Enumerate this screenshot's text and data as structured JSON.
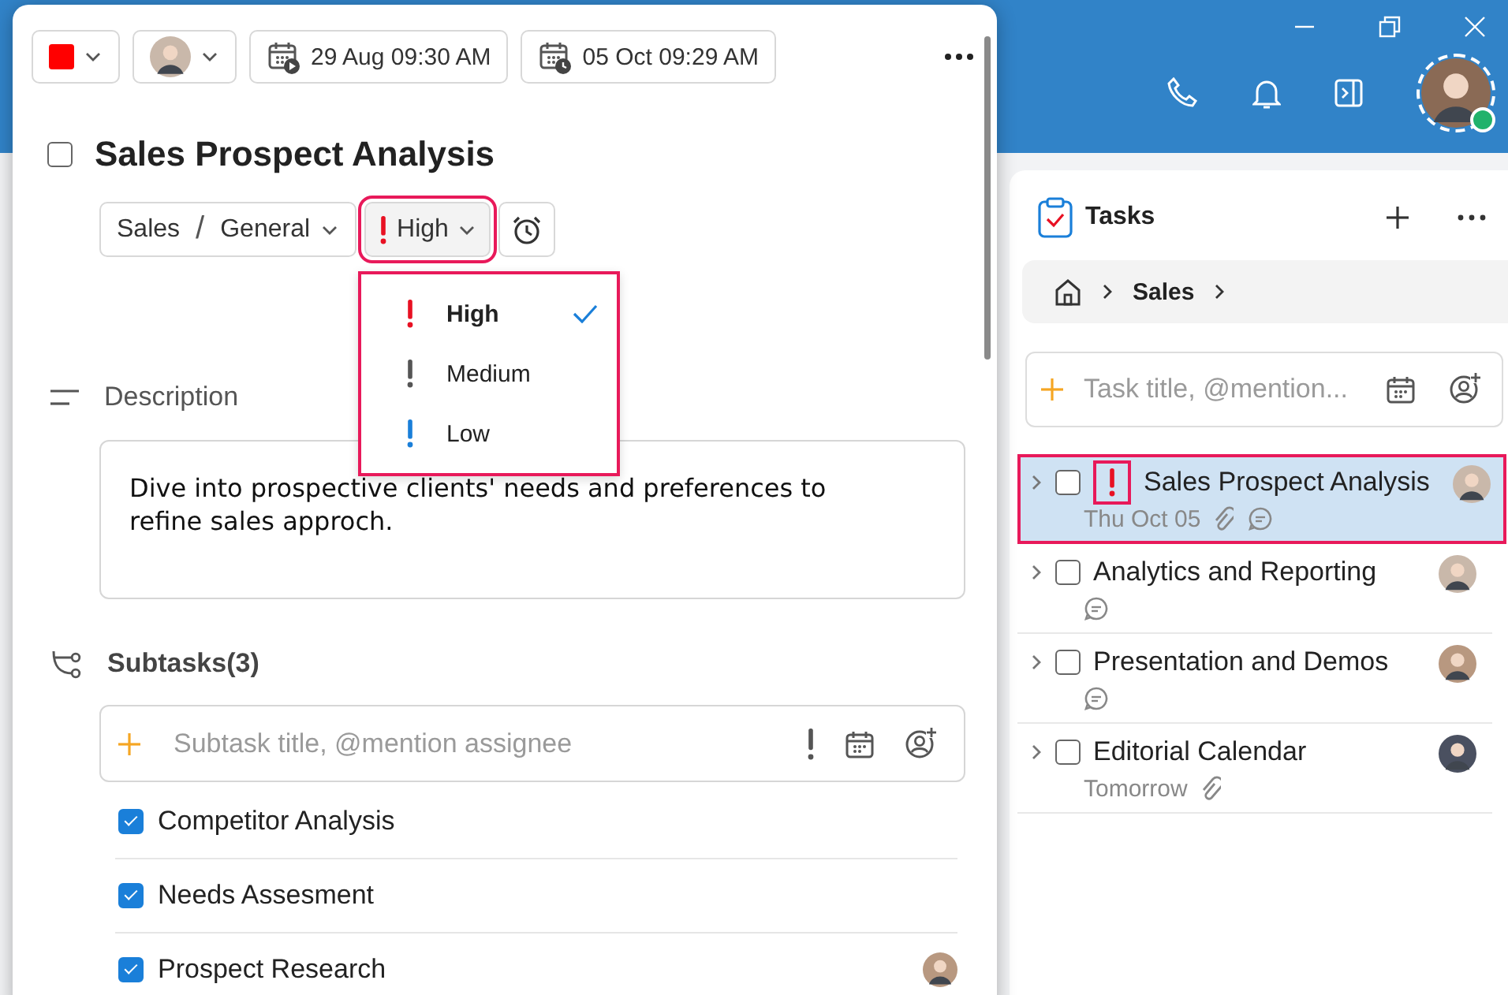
{
  "detail": {
    "flag": {
      "color": "#ff0000"
    },
    "start": "29 Aug 09:30 AM",
    "due": "05 Oct 09:29 AM",
    "title": "Sales Prospect Analysis",
    "checked": false,
    "project": "Sales",
    "separator": "/",
    "section": "General",
    "priority": {
      "kind": "high",
      "label": "High",
      "highlighted": true
    },
    "priority_menu": {
      "highlighted": true,
      "options": [
        {
          "kind": "high",
          "label": "High",
          "selected": true
        },
        {
          "kind": "medium",
          "label": "Medium",
          "selected": false
        },
        {
          "kind": "low",
          "label": "Low",
          "selected": false
        }
      ]
    },
    "description_label": "Description",
    "description": "Dive into prospective clients' needs and preferences to refine sales approch.",
    "subtasks_title": "Subtasks(3)",
    "subtask_input": {
      "placeholder": "Subtask title, @mention assignee"
    },
    "subtasks": [
      {
        "title": "Competitor Analysis",
        "checked": true,
        "assigned": false
      },
      {
        "title": "Needs Assesment",
        "checked": true,
        "assigned": false
      },
      {
        "title": "Prospect Research",
        "checked": true,
        "assigned": true
      }
    ]
  },
  "tasks_panel": {
    "title": "Tasks",
    "breadcrumb": [
      "Sales"
    ],
    "task_input": {
      "placeholder": "Task title, @mention..."
    },
    "tasks": [
      {
        "title": "Sales Prospect Analysis",
        "high_priority": true,
        "due": "Thu Oct 05",
        "attachment": true,
        "comment": true,
        "selected": true,
        "highlighted": true,
        "checked": false
      },
      {
        "title": "Analytics and Reporting",
        "high_priority": false,
        "attachment": false,
        "comment": true,
        "selected": false,
        "highlighted": false,
        "checked": false
      },
      {
        "title": "Presentation and Demos",
        "high_priority": false,
        "attachment": false,
        "comment": true,
        "selected": false,
        "highlighted": false,
        "checked": false
      },
      {
        "title": "Editorial Calendar",
        "high_priority": false,
        "due": "Tomorrow",
        "attachment": true,
        "comment": false,
        "selected": false,
        "highlighted": false,
        "checked": false
      }
    ]
  }
}
